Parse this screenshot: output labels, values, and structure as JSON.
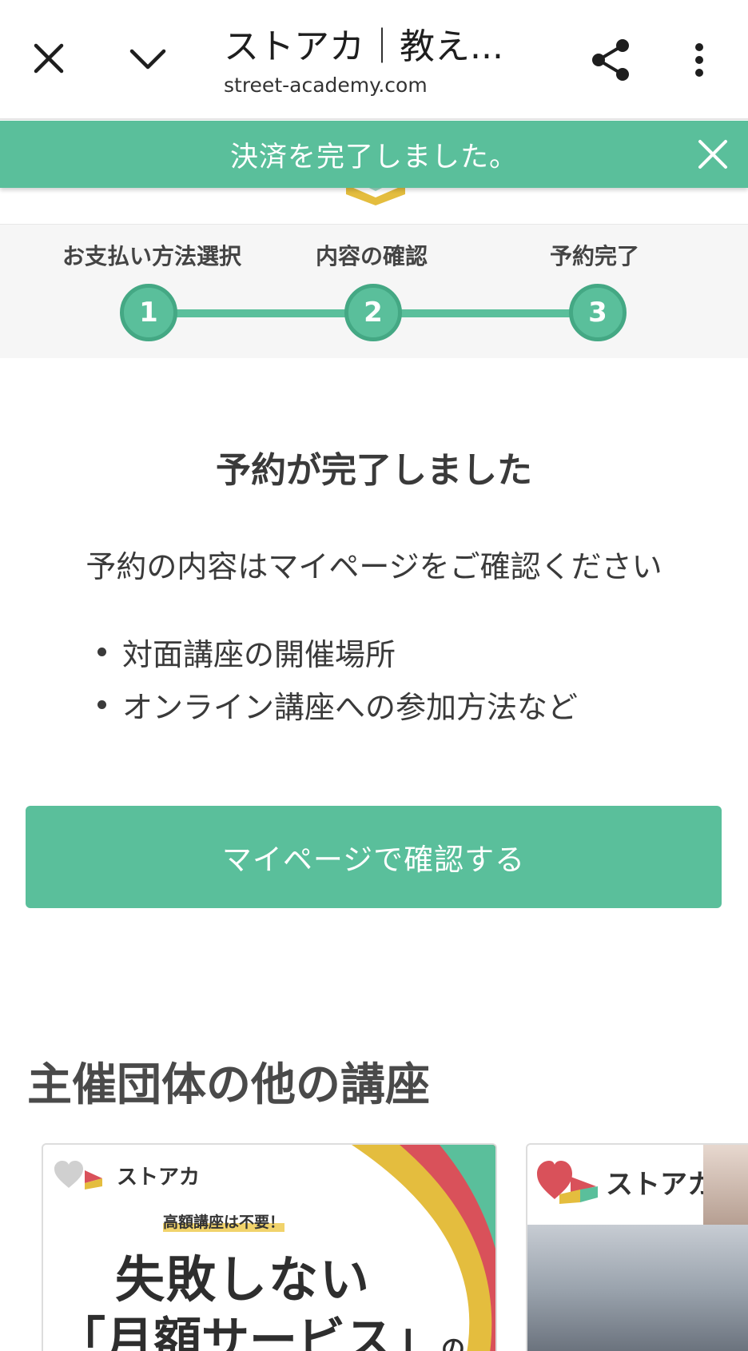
{
  "browser": {
    "title": "ストアカ｜教え...",
    "url": "street-academy.com",
    "icons": {
      "close": "close-icon",
      "collapse": "chevron-down-icon",
      "share": "share-icon",
      "more": "more-vert-icon"
    }
  },
  "toast": {
    "message": "決済を完了しました。",
    "close_icon": "close-icon"
  },
  "steps": [
    {
      "label": "お支払い方法選択",
      "number": "1"
    },
    {
      "label": "内容の確認",
      "number": "2"
    },
    {
      "label": "予約完了",
      "number": "3"
    }
  ],
  "completion": {
    "title": "予約が完了しました",
    "description": "予約の内容はマイページをご確認ください",
    "bullets": [
      "対面講座の開催場所",
      "オンライン講座への参加方法など"
    ],
    "cta_label": "マイページで確認する"
  },
  "related": {
    "section_title": "主催団体の他の講座",
    "card1": {
      "brand": "ストアカ",
      "subtitle": "高額講座は不要！",
      "headline1": "失敗しない",
      "headline2": "「月額サービス」",
      "headline2_suffix": "の"
    },
    "card2": {
      "brand": "ストアカ"
    }
  },
  "colors": {
    "accent": "#5abf9b",
    "accent_dark": "#44a884",
    "text": "#3a3a3a"
  }
}
